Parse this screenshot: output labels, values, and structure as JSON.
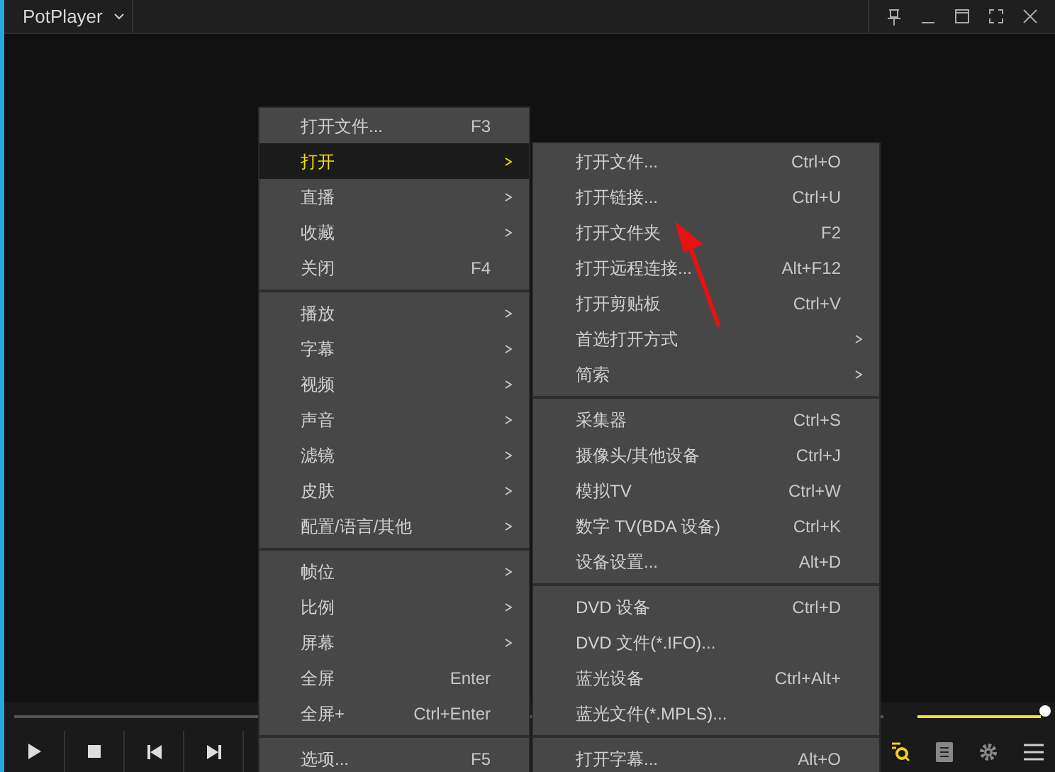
{
  "window": {
    "title": "PotPlayer"
  },
  "context_menu": {
    "items": [
      {
        "label": "打开文件...",
        "shortcut": "F3",
        "submenu": false,
        "selected": false
      },
      {
        "label": "打开",
        "submenu": true,
        "selected": true
      },
      {
        "label": "直播",
        "submenu": true,
        "selected": false
      },
      {
        "label": "收藏",
        "submenu": true,
        "selected": false
      },
      {
        "label": "关闭",
        "shortcut": "F4",
        "submenu": false,
        "selected": false,
        "separator_after": true
      },
      {
        "label": "播放",
        "submenu": true,
        "selected": false
      },
      {
        "label": "字幕",
        "submenu": true,
        "selected": false
      },
      {
        "label": "视频",
        "submenu": true,
        "selected": false
      },
      {
        "label": "声音",
        "submenu": true,
        "selected": false
      },
      {
        "label": "滤镜",
        "submenu": true,
        "selected": false
      },
      {
        "label": "皮肤",
        "submenu": true,
        "selected": false
      },
      {
        "label": "配置/语言/其他",
        "submenu": true,
        "selected": false,
        "separator_after": true
      },
      {
        "label": "帧位",
        "submenu": true,
        "selected": false
      },
      {
        "label": "比例",
        "submenu": true,
        "selected": false
      },
      {
        "label": "屏幕",
        "submenu": true,
        "selected": false
      },
      {
        "label": "全屏",
        "shortcut": "Enter",
        "submenu": false,
        "selected": false
      },
      {
        "label": "全屏+",
        "shortcut": "Ctrl+Enter",
        "submenu": false,
        "selected": false,
        "separator_after": true
      },
      {
        "label": "选项...",
        "shortcut": "F5",
        "submenu": false,
        "selected": false
      }
    ]
  },
  "submenu": {
    "items": [
      {
        "label": "打开文件...",
        "shortcut": "Ctrl+O",
        "submenu": false
      },
      {
        "label": "打开链接...",
        "shortcut": "Ctrl+U",
        "submenu": false
      },
      {
        "label": "打开文件夹",
        "shortcut": "F2",
        "submenu": false
      },
      {
        "label": "打开远程连接...",
        "shortcut": "Alt+F12",
        "submenu": false
      },
      {
        "label": "打开剪贴板",
        "shortcut": "Ctrl+V",
        "submenu": false
      },
      {
        "label": "首选打开方式",
        "submenu": true
      },
      {
        "label": "简索",
        "submenu": true,
        "separator_after": true
      },
      {
        "label": "采集器",
        "shortcut": "Ctrl+S",
        "submenu": false
      },
      {
        "label": "摄像头/其他设备",
        "shortcut": "Ctrl+J",
        "submenu": false
      },
      {
        "label": "模拟TV",
        "shortcut": "Ctrl+W",
        "submenu": false
      },
      {
        "label": "数字 TV(BDA 设备)",
        "shortcut": "Ctrl+K",
        "submenu": false
      },
      {
        "label": "设备设置...",
        "shortcut": "Alt+D",
        "submenu": false,
        "separator_after": true
      },
      {
        "label": "DVD 设备",
        "shortcut": "Ctrl+D",
        "submenu": false
      },
      {
        "label": "DVD 文件(*.IFO)...",
        "submenu": false
      },
      {
        "label": "蓝光设备",
        "shortcut": "Ctrl+Alt+",
        "submenu": false
      },
      {
        "label": "蓝光文件(*.MPLS)...",
        "submenu": false,
        "separator_after": true
      },
      {
        "label": "打开字幕...",
        "shortcut": "Alt+O",
        "submenu": false
      }
    ]
  },
  "controls": {
    "volume": {
      "level": 1
    }
  }
}
